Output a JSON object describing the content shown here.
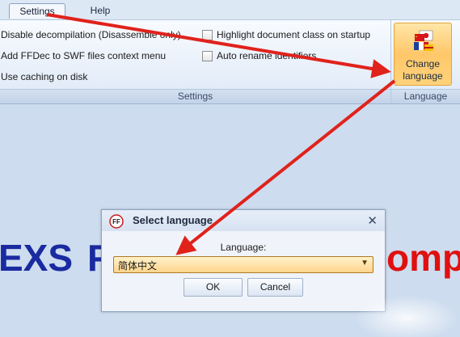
{
  "menu": {
    "tabs": [
      {
        "label": "Settings",
        "active": true
      },
      {
        "label": "Help",
        "active": false
      }
    ]
  },
  "ribbon": {
    "settings_group": {
      "label": "Settings",
      "options_left": [
        "Disable decompilation (Disassemble only)",
        "Add FFDec to SWF files context menu",
        "Use caching on disk"
      ],
      "options_right": [
        {
          "label": "Highlight document class on startup",
          "checked": false
        },
        {
          "label": "Auto rename identifiers",
          "checked": false
        }
      ]
    },
    "language_group": {
      "label": "Language",
      "button_line1": "Change",
      "button_line2": "language"
    }
  },
  "background_text": {
    "left": "EXS",
    "middle": "F",
    "right": "omp"
  },
  "dialog": {
    "title": "Select language",
    "icon_text": "FF",
    "close": "✕",
    "language_label": "Language:",
    "selected_language": "简体中文",
    "ok_label": "OK",
    "cancel_label": "Cancel"
  },
  "colors": {
    "annotation_arrow": "#e0221b",
    "bg_text_blue": "#1a2aa0",
    "bg_text_red": "#e01010",
    "highlight_button": "#ffc76a"
  }
}
